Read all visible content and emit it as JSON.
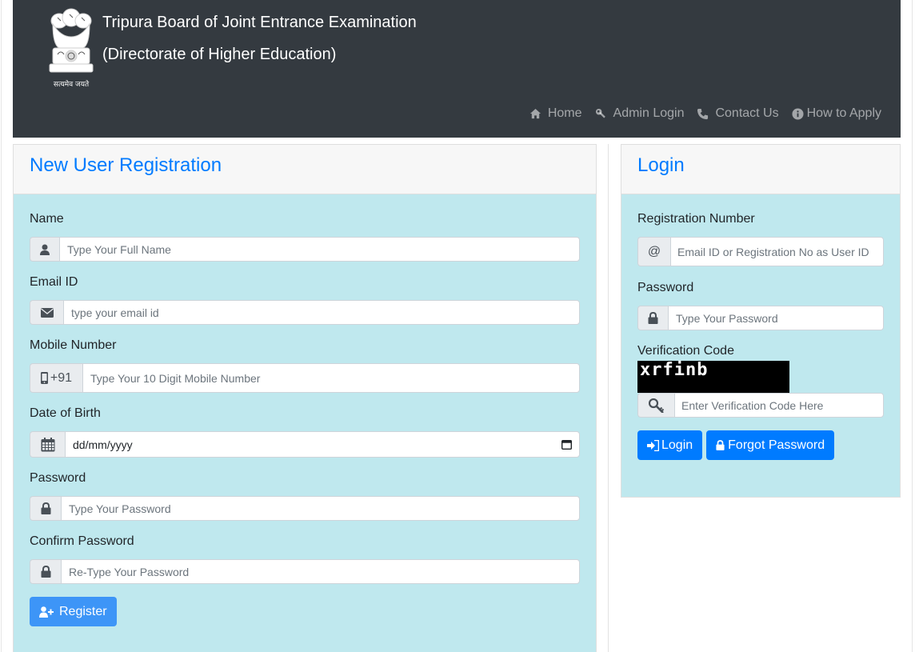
{
  "header": {
    "title": "Tripura Board of Joint Entrance Examination",
    "subtitle": "(Directorate of Higher Education)",
    "emblem_motto": "सत्यमेव जयते",
    "nav": [
      {
        "label": "Home",
        "icon": "home-icon"
      },
      {
        "label": "Admin Login",
        "icon": "key-icon"
      },
      {
        "label": "Contact Us",
        "icon": "phone-icon"
      },
      {
        "label": "How to Apply",
        "icon": "info-icon"
      }
    ]
  },
  "registration": {
    "heading": "New User Registration",
    "fields": {
      "name": {
        "label": "Name",
        "placeholder": "Type Your Full Name",
        "icon": "user-icon"
      },
      "email": {
        "label": "Email ID",
        "placeholder": "type your email id",
        "icon": "envelope-icon"
      },
      "mobile": {
        "label": "Mobile Number",
        "prefix": "+91",
        "placeholder": "Type Your 10 Digit Mobile Number",
        "icon": "mobile-icon"
      },
      "dob": {
        "label": "Date of Birth",
        "value": "dd/mm/yyyy",
        "icon": "calendar-icon"
      },
      "password": {
        "label": "Password",
        "placeholder": "Type Your Password",
        "icon": "lock-icon"
      },
      "confirm": {
        "label": "Confirm Password",
        "placeholder": "Re-Type Your Password",
        "icon": "lock-icon"
      }
    },
    "register_label": "Register"
  },
  "login": {
    "heading": "Login",
    "reg_label": "Registration Number",
    "reg_addon": "@",
    "reg_placeholder": "Email ID or Registration No as User ID",
    "password_label": "Password",
    "password_placeholder": "Type Your Password",
    "verification_label": "Verification Code",
    "captcha_text": "xrfinb",
    "verification_placeholder": "Enter Verification Code Here",
    "login_label": "Login",
    "forgot_label": "Forgot Password"
  },
  "colors": {
    "header_bg": "#343a40",
    "card_body_bg": "#bfe8ee",
    "accent": "#007bff"
  }
}
